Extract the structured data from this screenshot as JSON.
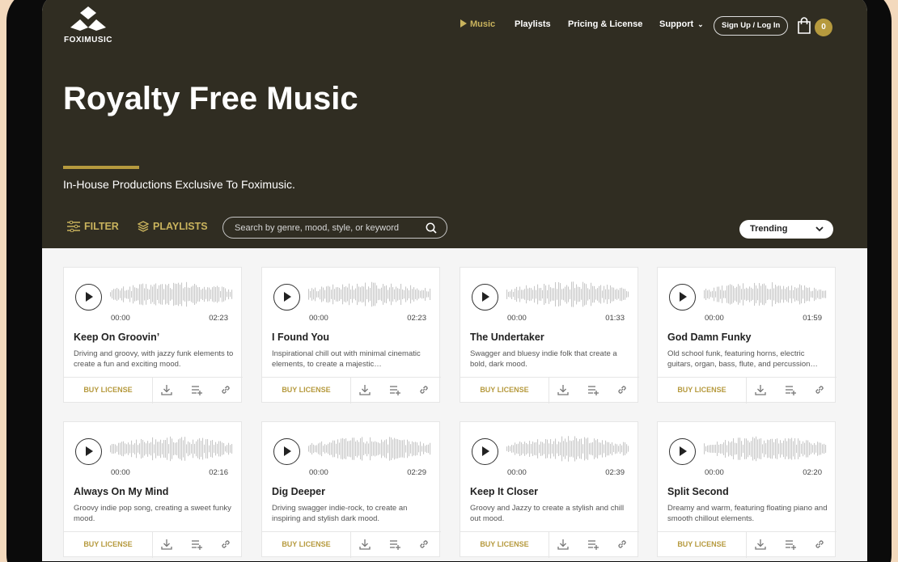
{
  "brand": {
    "name": "FOXIMUSIC",
    "accent": "#b69a3e",
    "hero_bg": "#302d22"
  },
  "nav": {
    "music": "Music",
    "playlists": "Playlists",
    "pricing": "Pricing & License",
    "support": "Support",
    "signup": "Sign Up / Log In",
    "cart_count": "0"
  },
  "hero": {
    "title": "Royalty Free Music",
    "subtitle": "In-House Productions Exclusive To Foximusic."
  },
  "toolbar": {
    "filter": "FILTER",
    "playlists": "PLAYLISTS",
    "search_placeholder": "Search by genre, mood, style, or keyword",
    "sort": "Trending"
  },
  "card_actions": {
    "buy": "BUY LICENSE",
    "icons": [
      "download-icon",
      "add-to-playlist-icon",
      "link-icon"
    ]
  },
  "tracks": [
    {
      "title": "Keep On Groovin’",
      "desc": "Driving and groovy, with jazzy funk elements to create a fun and exciting mood.",
      "start": "00:00",
      "duration": "02:23"
    },
    {
      "title": "I Found You",
      "desc": "Inspirational chill out with minimal cinematic elements, to create a majestic…",
      "start": "00:00",
      "duration": "02:23"
    },
    {
      "title": "The Undertaker",
      "desc": "Swagger and bluesy indie folk that create a bold, dark mood.",
      "start": "00:00",
      "duration": "01:33"
    },
    {
      "title": "God Damn Funky",
      "desc": "Old school funk, featuring horns, electric guitars, organ, bass, flute, and percussion…",
      "start": "00:00",
      "duration": "01:59"
    },
    {
      "title": "Always On My Mind",
      "desc": "Groovy indie pop song, creating a sweet funky mood.",
      "start": "00:00",
      "duration": "02:16"
    },
    {
      "title": "Dig Deeper",
      "desc": "Driving swagger indie-rock, to create an inspiring and stylish dark mood.",
      "start": "00:00",
      "duration": "02:29"
    },
    {
      "title": "Keep It Closer",
      "desc": "Groovy and Jazzy to create a stylish and chill out mood.",
      "start": "00:00",
      "duration": "02:39"
    },
    {
      "title": "Split Second",
      "desc": "Dreamy and warm, featuring floating piano and smooth chillout elements.",
      "start": "00:00",
      "duration": "02:20"
    }
  ]
}
